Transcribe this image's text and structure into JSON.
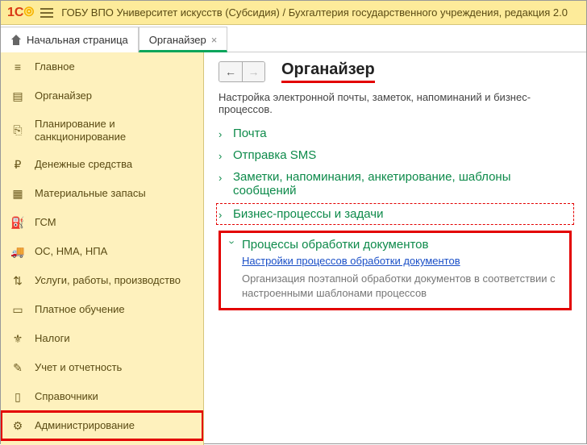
{
  "header": {
    "title": "ГОБУ ВПО Университет искусств (Субсидия) / Бухгалтерия государственного учреждения, редакция 2.0"
  },
  "tabs": {
    "home": "Начальная страница",
    "organizer": "Органайзер"
  },
  "sidebar": {
    "items": [
      {
        "label": "Главное",
        "icon": "≡"
      },
      {
        "label": "Органайзер",
        "icon": "▤"
      },
      {
        "label": "Планирование и санкционирование",
        "icon": "⎘"
      },
      {
        "label": "Денежные средства",
        "icon": "₽"
      },
      {
        "label": "Материальные запасы",
        "icon": "▦"
      },
      {
        "label": "ГСМ",
        "icon": "⛽"
      },
      {
        "label": "ОС, НМА, НПА",
        "icon": "🚚"
      },
      {
        "label": "Услуги, работы, производство",
        "icon": "⇅"
      },
      {
        "label": "Платное обучение",
        "icon": "▭"
      },
      {
        "label": "Налоги",
        "icon": "⚜"
      },
      {
        "label": "Учет и отчетность",
        "icon": "✎"
      },
      {
        "label": "Справочники",
        "icon": "▯"
      },
      {
        "label": "Администрирование",
        "icon": "⚙"
      }
    ]
  },
  "page": {
    "title": "Органайзер",
    "subtitle": "Настройка электронной почты, заметок, напоминаний и бизнес-процессов.",
    "sections": [
      {
        "label": "Почта"
      },
      {
        "label": "Отправка SMS"
      },
      {
        "label": "Заметки, напоминания, анкетирование, шаблоны сообщений"
      },
      {
        "label": "Бизнес-процессы и задачи"
      }
    ],
    "expanded": {
      "title": "Процессы обработки документов",
      "link": "Настройки процессов обработки документов",
      "desc": "Организация поэтапной обработки документов в соответствии с настроенными шаблонами процессов"
    }
  }
}
